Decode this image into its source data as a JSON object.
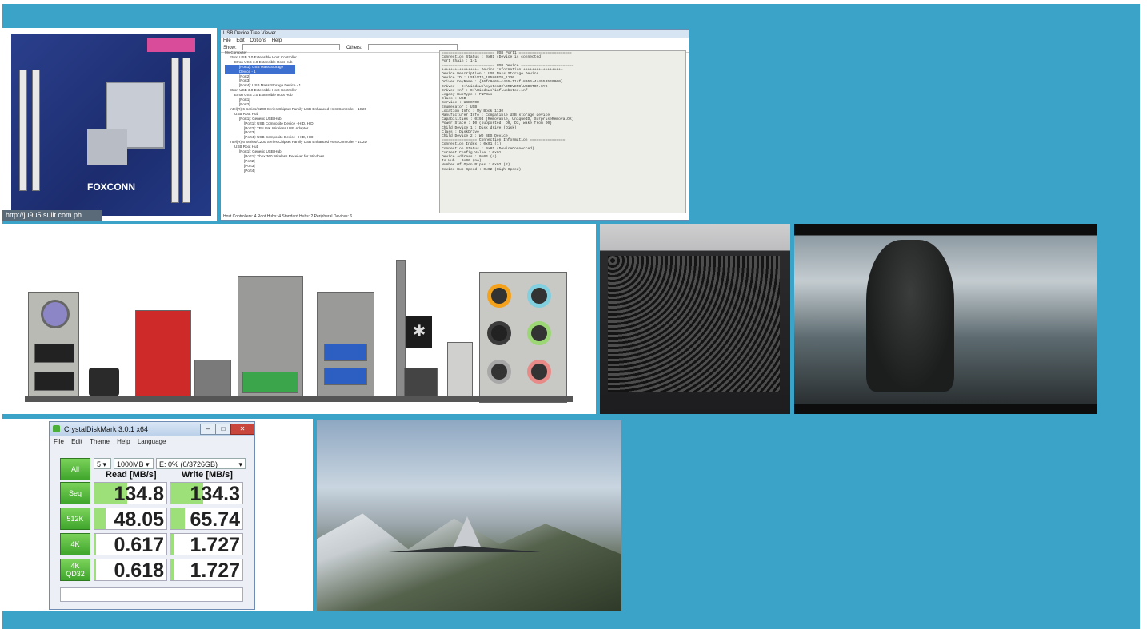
{
  "motherboard": {
    "brand": "FOXCONN",
    "url": "http://ju9u5.sulit.com.ph"
  },
  "usb_viewer": {
    "menu": [
      "File",
      "Edit",
      "Options",
      "Help"
    ],
    "show_label": "Show:",
    "others_label": "Others:",
    "tree": [
      "My Computer",
      "Etron USB 3.0 Extensible Host Controller",
      "Etron USB 3.0 Extensible Root Hub",
      "[Port1]: USB Mass Storage Device - 1",
      "[Port2]",
      "[Port3]",
      "[Port4]: USB Mass Storage Device - 1",
      "Etron USB 3.0 Extensible Host Controller",
      "Etron USB 3.0 Extensible Root Hub",
      "[Port1]",
      "[Port2]",
      "Intel(R) 6 Series/C200 Series Chipset Family USB Enhanced Host Controller - 1C26",
      "USB Root Hub",
      "[Port1]: Generic USB Hub",
      "[Port1]: USB Composite Device - HID, HID",
      "[Port2]: TP-LINK Wireless USB Adapter",
      "[Port3]",
      "[Port4]: USB Composite Device - HID, HID",
      "Intel(R) 6 Series/C200 Series Chipset Family USB Enhanced Host Controller - 1C2D",
      "USB Root Hub",
      "[Port1]: Generic USB Hub",
      "[Port1]: Xbox 360 Wireless Receiver for Windows",
      "[Port2]",
      "[Port3]",
      "[Port4]"
    ],
    "panel": [
      "======================== USB Port1 ========================",
      "Connection Status      : 0x01 (Device is connected)",
      "Port Chain             : 1-1",
      "======================== USB Device ========================",
      "+++++++++++++++++ Device Information ++++++++++++++++++",
      "Device Description     : USB Mass Storage Device",
      "Device ID              : USB\\VID_1058&PID_1130",
      "Driver KeyName         : {36fc9e60-c465-11cf-8056-444553540000}",
      "Driver                 : C:\\Windows\\system32\\DRIVERS\\USBSTOR.SYS",
      "Driver Inf             : C:\\Windows\\inf\\usbstor.inf",
      "Legacy BusType         : PNPBus",
      "Class                  : USB",
      "Service                : USBSTOR",
      "Enumerator             : USB",
      "Location Info          : My Book 1130",
      "Manufacturer Info      : Compatible USB storage device",
      "Capabilities           : 0x94 (Removable, UniqueID, SurpriseRemovalOK)",
      "Power State            : D0 (supported: D0, D3, wake from D0)",
      " Child Device 1        : Disk drive (Disk)",
      "  Class                : DiskDrive",
      " Child Device 2        : WD SES Device",
      "================ Connection Information ================",
      "Connection Index       : 0x01 (1)",
      "Connection Status      : 0x01 (DeviceConnected)",
      "Current Config Value   : 0x01",
      "Device Address         : 0x04 (4)",
      "Is Hub                 : 0x00 (no)",
      "Number Of Open Pipes   : 0x02 (2)",
      "Device Bus Speed       : 0x02 (High-Speed)"
    ],
    "status": "Host Controllers: 4    Root Hubs: 4    Standard Hubs: 2    Peripheral Devices: 6"
  },
  "crystaldiskmark": {
    "title": "CrystalDiskMark 3.0.1 x64",
    "menu": [
      "File",
      "Edit",
      "Theme",
      "Help",
      "Language"
    ],
    "count": "5",
    "size": "1000MB",
    "drive": "E: 0% (0/3726GB)",
    "all_label": "All",
    "read_header": "Read [MB/s]",
    "write_header": "Write [MB/s]",
    "rows": [
      {
        "label": "Seq",
        "read": "134.8",
        "write": "134.3",
        "read_fill": 0.45,
        "write_fill": 0.45
      },
      {
        "label": "512K",
        "read": "48.05",
        "write": "65.74",
        "read_fill": 0.15,
        "write_fill": 0.2
      },
      {
        "label": "4K",
        "read": "0.617",
        "write": "1.727",
        "read_fill": 0.02,
        "write_fill": 0.04
      },
      {
        "label": "4K QD32",
        "read": "0.618",
        "write": "1.727",
        "read_fill": 0.02,
        "write_fill": 0.04
      }
    ]
  },
  "colors": {
    "background": "#3ba2c8",
    "bar_green": "#9de07a"
  }
}
